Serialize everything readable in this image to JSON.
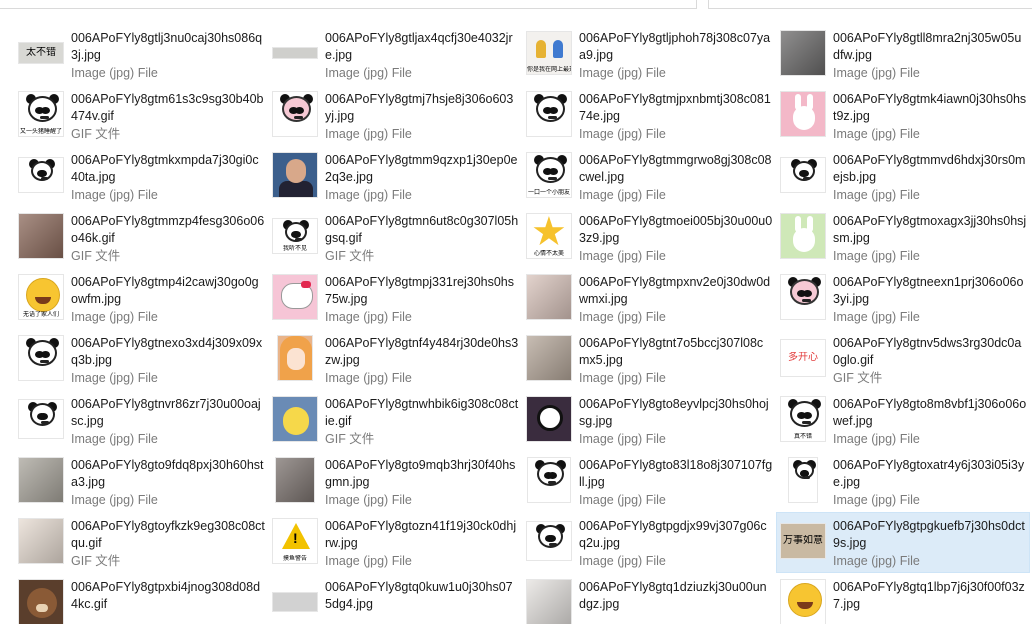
{
  "items": [
    {
      "name": "006APoFYly8gtlj3nu0caj30hs086q3j.jpg",
      "type": "Image (jpg) File",
      "thumb": {
        "kind": "text",
        "bg": "#d8d8d4",
        "text": "太不错",
        "w": 46,
        "h": 22
      }
    },
    {
      "name": "006APoFYly8gtljax4qcfj30e4032jre.jpg",
      "type": "Image (jpg) File",
      "thumb": {
        "kind": "text",
        "bg": "#cfcfcc",
        "text": "",
        "w": 46,
        "h": 12
      }
    },
    {
      "name": "006APoFYly8gtljphoh78j308c07yaa9.jpg",
      "type": "Image (jpg) File",
      "thumb": {
        "kind": "figures",
        "bg": "#f3f1ee",
        "text": "你是我在网上最开心的朋友",
        "w": 46,
        "h": 44
      }
    },
    {
      "name": "006APoFYly8gtll8mra2nj305w05udfw.jpg",
      "type": "Image (jpg) File",
      "thumb": {
        "kind": "photo",
        "bg": "#6b6a6a",
        "text": "",
        "w": 46,
        "h": 46
      }
    },
    {
      "name": "006APoFYly8gtm61s3c9sg30b40b474v.gif",
      "type": "GIF 文件",
      "thumb": {
        "kind": "panda",
        "bg": "#ffffff",
        "text": "又一头猪睡醒了",
        "w": 46,
        "h": 46
      }
    },
    {
      "name": "006APoFYly8gtmj7hsje8j306o603yj.jpg",
      "type": "Image (jpg) File",
      "thumb": {
        "kind": "pinkpanda",
        "bg": "#ffffff",
        "text": "",
        "w": 46,
        "h": 46
      }
    },
    {
      "name": "006APoFYly8gtmjpxnbmtj308c08174e.jpg",
      "type": "Image (jpg) File",
      "thumb": {
        "kind": "panda",
        "bg": "#ffffff",
        "text": "",
        "w": 46,
        "h": 46
      }
    },
    {
      "name": "006APoFYly8gtmk4iawn0j30hs0hst9z.jpg",
      "type": "Image (jpg) File",
      "thumb": {
        "kind": "rabbit",
        "bg": "#f3b8c8",
        "text": "",
        "w": 46,
        "h": 46
      }
    },
    {
      "name": "006APoFYly8gtmkxmpda7j30gi0c40ta.jpg",
      "type": "Image (jpg) File",
      "thumb": {
        "kind": "panda",
        "bg": "#ffffff",
        "text": "",
        "w": 46,
        "h": 36
      }
    },
    {
      "name": "006APoFYly8gtmm9qzxp1j30ep0e2q3e.jpg",
      "type": "Image (jpg) File",
      "thumb": {
        "kind": "man",
        "bg": "#3c5f8c",
        "text": "",
        "w": 46,
        "h": 46
      }
    },
    {
      "name": "006APoFYly8gtmmgrwo8gj308c08cwel.jpg",
      "type": "Image (jpg) File",
      "thumb": {
        "kind": "panda",
        "bg": "#ffffff",
        "text": "一口一个小朋友",
        "w": 46,
        "h": 46
      }
    },
    {
      "name": "006APoFYly8gtmmvd6hdxj30rs0mejsb.jpg",
      "type": "Image (jpg) File",
      "thumb": {
        "kind": "panda",
        "bg": "#ffffff",
        "text": "",
        "w": 46,
        "h": 36
      }
    },
    {
      "name": "006APoFYly8gtmmzp4fesg306o06o46k.gif",
      "type": "GIF 文件",
      "thumb": {
        "kind": "photo",
        "bg": "#8c6a5c",
        "text": "",
        "w": 46,
        "h": 46
      }
    },
    {
      "name": "006APoFYly8gtmn6ut8c0g307l05hgsq.gif",
      "type": "GIF 文件",
      "thumb": {
        "kind": "panda",
        "bg": "#ffffff",
        "text": "我听不见",
        "w": 46,
        "h": 36
      }
    },
    {
      "name": "006APoFYly8gtmoei005bj30u00u03z9.jpg",
      "type": "Image (jpg) File",
      "thumb": {
        "kind": "star",
        "bg": "#ffffff",
        "text": "心情不太美",
        "w": 46,
        "h": 46
      }
    },
    {
      "name": "006APoFYly8gtmoxagx3jj30hs0hsjsm.jpg",
      "type": "Image (jpg) File",
      "thumb": {
        "kind": "bunny",
        "bg": "#cfe8b8",
        "text": "",
        "w": 46,
        "h": 46
      }
    },
    {
      "name": "006APoFYly8gtmp4i2cawj30go0gowfm.jpg",
      "type": "Image (jpg) File",
      "thumb": {
        "kind": "emoji",
        "bg": "#ffffff",
        "text": "无语了家人们",
        "w": 46,
        "h": 46
      }
    },
    {
      "name": "006APoFYly8gtmpj331rej30hs0hs75w.jpg",
      "type": "Image (jpg) File",
      "thumb": {
        "kind": "kitty",
        "bg": "#f6c5d6",
        "text": "",
        "w": 46,
        "h": 46
      }
    },
    {
      "name": "006APoFYly8gtmpxnv2e0j30dw0dwmxi.jpg",
      "type": "Image (jpg) File",
      "thumb": {
        "kind": "photo",
        "bg": "#d9c4bc",
        "text": "",
        "w": 46,
        "h": 46
      }
    },
    {
      "name": "006APoFYly8gtneexn1prj306o06o3yi.jpg",
      "type": "Image (jpg) File",
      "thumb": {
        "kind": "pinkpanda",
        "bg": "#ffffff",
        "text": "",
        "w": 46,
        "h": 46
      }
    },
    {
      "name": "006APoFYly8gtnexo3xd4j309x09xq3b.jpg",
      "type": "Image (jpg) File",
      "thumb": {
        "kind": "panda",
        "bg": "#ffffff",
        "text": "",
        "w": 46,
        "h": 46
      }
    },
    {
      "name": "006APoFYly8gtnf4y484rj30de0hs3zw.jpg",
      "type": "Image (jpg) File",
      "thumb": {
        "kind": "anime",
        "bg": "#e9b48a",
        "text": "",
        "w": 36,
        "h": 46
      }
    },
    {
      "name": "006APoFYly8gtnt7o5bccj307l08cmx5.jpg",
      "type": "Image (jpg) File",
      "thumb": {
        "kind": "photo",
        "bg": "#b5a79a",
        "text": "",
        "w": 46,
        "h": 46
      }
    },
    {
      "name": "006APoFYly8gtnv5dws3rg30dc0a0glo.gif",
      "type": "GIF 文件",
      "thumb": {
        "kind": "text",
        "bg": "#ffffff",
        "text": "多开心",
        "w": 46,
        "h": 38
      }
    },
    {
      "name": "006APoFYly8gtnvr86zr7j30u00oajsc.jpg",
      "type": "Image (jpg) File",
      "thumb": {
        "kind": "panda",
        "bg": "#ffffff",
        "text": "",
        "w": 46,
        "h": 40
      }
    },
    {
      "name": "006APoFYly8gtnwhbik6ig308c08ctie.gif",
      "type": "GIF 文件",
      "thumb": {
        "kind": "chick",
        "bg": "#6a8bb5",
        "text": "",
        "w": 46,
        "h": 46
      }
    },
    {
      "name": "006APoFYly8gto8eyvlpcj30hs0hojsg.jpg",
      "type": "Image (jpg) File",
      "thumb": {
        "kind": "kuromi",
        "bg": "#3a2c3e",
        "text": "",
        "w": 46,
        "h": 46
      }
    },
    {
      "name": "006APoFYly8gto8m8vbf1j306o06owef.jpg",
      "type": "Image (jpg) File",
      "thumb": {
        "kind": "panda",
        "bg": "#ffffff",
        "text": "真不错",
        "w": 46,
        "h": 46
      }
    },
    {
      "name": "006APoFYly8gto9fdq8pxj30h60hsta3.jpg",
      "type": "Image (jpg) File",
      "thumb": {
        "kind": "photo",
        "bg": "#a9a59c",
        "text": "",
        "w": 46,
        "h": 46
      }
    },
    {
      "name": "006APoFYly8gto9mqb3hrj30f40hsgmn.jpg",
      "type": "Image (jpg) File",
      "thumb": {
        "kind": "photo",
        "bg": "#7d7470",
        "text": "",
        "w": 40,
        "h": 46
      }
    },
    {
      "name": "006APoFYly8gto83l18o8j307107fgll.jpg",
      "type": "Image (jpg) File",
      "thumb": {
        "kind": "panda",
        "bg": "#ffffff",
        "text": "",
        "w": 44,
        "h": 46
      }
    },
    {
      "name": "006APoFYly8gtoxatr4y6j303i05i3ye.jpg",
      "type": "Image (jpg) File",
      "thumb": {
        "kind": "panda",
        "bg": "#ffffff",
        "text": "",
        "w": 30,
        "h": 46
      }
    },
    {
      "name": "006APoFYly8gtoyfkzk9eg308c08ctqu.gif",
      "type": "GIF 文件",
      "thumb": {
        "kind": "photo",
        "bg": "#e7dcd2",
        "text": "",
        "w": 46,
        "h": 46
      }
    },
    {
      "name": "006APoFYly8gtozn41f19j30ck0dhjrw.jpg",
      "type": "Image (jpg) File",
      "thumb": {
        "kind": "warning",
        "bg": "#ffffff",
        "text": "摸鱼警告",
        "w": 46,
        "h": 46
      }
    },
    {
      "name": "006APoFYly8gtpgdjx99vj307g06cq2u.jpg",
      "type": "Image (jpg) File",
      "thumb": {
        "kind": "panda",
        "bg": "#ffffff",
        "text": "",
        "w": 46,
        "h": 40
      }
    },
    {
      "name": "006APoFYly8gtpgkuefb7j30hs0dct9s.jpg",
      "type": "Image (jpg) File",
      "selected": true,
      "thumb": {
        "kind": "text",
        "bg": "#c9b9a2",
        "text": "万事如意",
        "w": 46,
        "h": 36
      }
    },
    {
      "name": "006APoFYly8gtpxbi4jnog308d08d4kc.gif",
      "type": "",
      "thumb": {
        "kind": "dog",
        "bg": "#5a3e2c",
        "text": "",
        "w": 46,
        "h": 46
      }
    },
    {
      "name": "006APoFYly8gtq0kuw1u0j30hs075dg4.jpg",
      "type": "",
      "thumb": {
        "kind": "text",
        "bg": "#d2d2d2",
        "text": "",
        "w": 46,
        "h": 20
      }
    },
    {
      "name": "006APoFYly8gtq1dziuzkj30u00undgz.jpg",
      "type": "",
      "thumb": {
        "kind": "photo",
        "bg": "#e6e3e0",
        "text": "",
        "w": 46,
        "h": 46
      }
    },
    {
      "name": "006APoFYly8gtq1lbp7j6j30f00f03z7.jpg",
      "type": "",
      "thumb": {
        "kind": "emoji",
        "bg": "#ffffff",
        "text": "",
        "w": 46,
        "h": 46
      }
    }
  ],
  "colors": {
    "selection_bg": "#dcebf8",
    "name_text": "#1a1a1a",
    "type_text": "#7a7a7a"
  }
}
